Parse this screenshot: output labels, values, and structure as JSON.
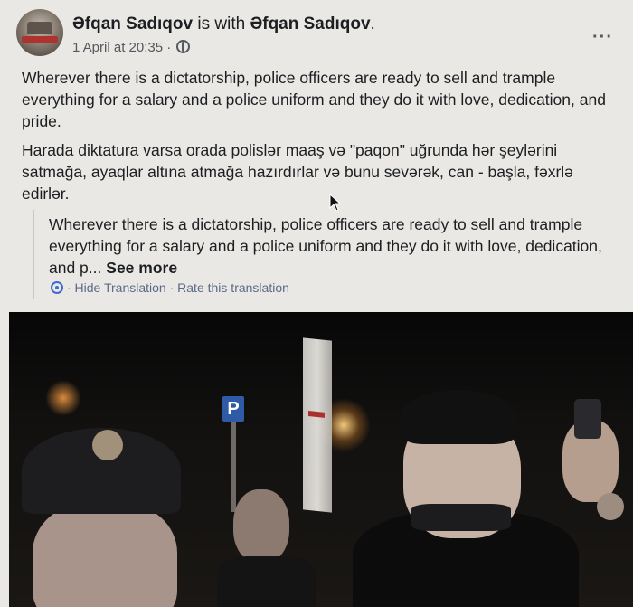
{
  "post": {
    "author": "Əfqan Sadıqov",
    "with_text": "is with",
    "tagged": "Əfqan Sadıqov",
    "date": "1 April at 20:35 ·",
    "more": "···",
    "text_en": "Wherever there is a dictatorship, police officers are ready to sell and trample everything for a salary and a police uniform and they do it with love, dedication, and pride.",
    "text_az": "Harada diktatura varsa orada  polislər maaş və \"paqon\" uğrunda hər şeylərini satmağa,  ayaqlar altına atmağa hazırdırlar və bunu sevərək, can - başla, fəxrlə edirlər.",
    "translation_text": "Wherever there is a dictatorship, police officers are ready to sell and trample everything for a salary and a police uniform and they do it with love, dedication, and p...",
    "see_more": "See more",
    "hide_translation": "· Hide Translation",
    "rate_translation": "· Rate this translation"
  },
  "photo": {
    "sign_letter": "P"
  },
  "icons": {
    "privacy": "globe-icon",
    "options": "more-icon",
    "translation": "translate-icon",
    "pointer": "cursor-icon"
  }
}
